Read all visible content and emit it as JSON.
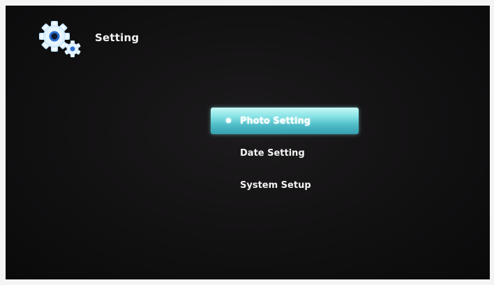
{
  "header": {
    "title": "Setting",
    "icon": "gears-icon"
  },
  "menu": {
    "items": [
      {
        "label": "Photo Setting",
        "selected": true
      },
      {
        "label": "Date Setting",
        "selected": false
      },
      {
        "label": "System Setup",
        "selected": false
      }
    ]
  },
  "colors": {
    "background": "#121112",
    "highlight": "#5cc9d2",
    "icon": "#e8f6ff",
    "text": "#f5f5f5"
  }
}
